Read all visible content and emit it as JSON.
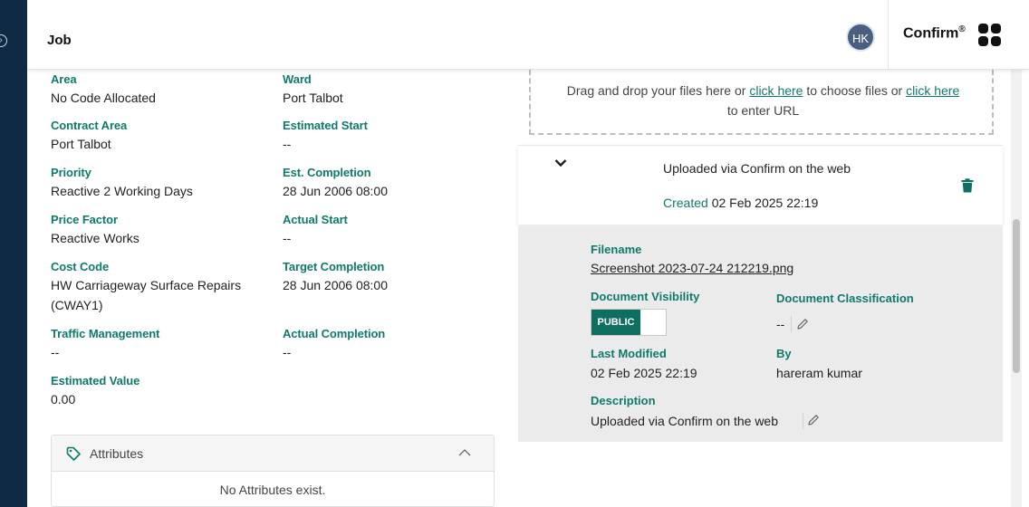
{
  "header": {
    "title": "Job",
    "avatar_initials": "HK",
    "brand": "Confirm",
    "brand_mark": "®"
  },
  "fields": {
    "area": {
      "label": "Area",
      "value": "No Code Allocated"
    },
    "ward": {
      "label": "Ward",
      "value": "Port Talbot"
    },
    "contract_area": {
      "label": "Contract Area",
      "value": "Port Talbot"
    },
    "estimated_start": {
      "label": "Estimated Start",
      "value": "--"
    },
    "priority": {
      "label": "Priority",
      "value": "Reactive 2 Working Days"
    },
    "est_completion": {
      "label": "Est. Completion",
      "value": "28 Jun 2006 08:00"
    },
    "price_factor": {
      "label": "Price Factor",
      "value": "Reactive Works"
    },
    "actual_start": {
      "label": "Actual Start",
      "value": "--"
    },
    "cost_code": {
      "label": "Cost Code",
      "value_line1": "HW Carriageway Surface Repairs",
      "value_line2": "(CWAY1)"
    },
    "target_completion": {
      "label": "Target Completion",
      "value": "28 Jun 2006 08:00"
    },
    "traffic_management": {
      "label": "Traffic Management",
      "value": "--"
    },
    "actual_completion": {
      "label": "Actual Completion",
      "value": "--"
    },
    "estimated_value": {
      "label": "Estimated Value",
      "value": "0.00"
    }
  },
  "attributes": {
    "title": "Attributes",
    "empty_text": "No Attributes exist."
  },
  "dropzone": {
    "text_before": "Drag and drop your files here or ",
    "link1": "click here",
    "text_middle": " to choose files or ",
    "link2": "click here",
    "text_after": "to enter URL"
  },
  "document": {
    "title": "Uploaded via Confirm on the web",
    "created_label": "Created",
    "created_value": "02 Feb 2025 22:19",
    "filename_label": "Filename",
    "filename": "Screenshot 2023-07-24 212219.png",
    "visibility_label": "Document Visibility",
    "visibility_value": "PUBLIC",
    "classification_label": "Document Classification",
    "classification_value": "--",
    "last_modified_label": "Last Modified",
    "last_modified_value": "02 Feb 2025 22:19",
    "by_label": "By",
    "by_value": "hareram kumar",
    "description_label": "Description",
    "description_value": "Uploaded via Confirm on the web"
  },
  "colors": {
    "accent": "#0f7a6c",
    "rail": "#0f2a44",
    "toggle_on": "#0f6e62"
  }
}
